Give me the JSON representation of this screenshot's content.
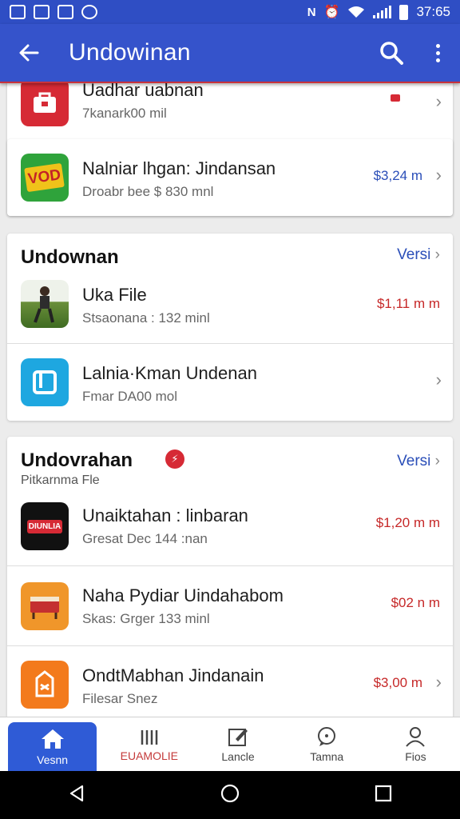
{
  "status_bar": {
    "time": "37:65"
  },
  "app_bar": {
    "title": "Undowinan"
  },
  "top_card": {
    "items": [
      {
        "title": "Uadhar uabnan",
        "subtitle": "7kanark00 mil",
        "price": ""
      },
      {
        "title": "Nalniar lhgan: Jindansan",
        "subtitle": "Droabr bee $ 830 mnl",
        "price": "$3,24 m"
      }
    ]
  },
  "section_one": {
    "title": "Undownan",
    "more_label": "Versi",
    "items": [
      {
        "title": "Uka File",
        "subtitle": "Stsaonana : 132 minl",
        "price": "$1,11 m m"
      },
      {
        "title": "Lalnia·Kman Undenan",
        "subtitle": "Fmar DA00 mol",
        "price": ""
      }
    ]
  },
  "section_two": {
    "title": "Undovrahan",
    "subtitle": "Pitkarnma Fle",
    "more_label": "Versi",
    "items": [
      {
        "title": "Unaiktahan : linbaran",
        "subtitle": "Gresat Dec 144 :nan",
        "price": "$1,20 m m",
        "icon_text": "DIUNLIA"
      },
      {
        "title": "Naha Pydiar Uindahabom",
        "subtitle": "Skas: Grger 133 minl",
        "price": "$02 n m"
      },
      {
        "title": "OndtMabhan Jindanain",
        "subtitle": "Filesar Snez",
        "price": "$3,00 m"
      }
    ]
  },
  "bottom_nav": [
    {
      "label": "Vesnn",
      "icon": "home-icon",
      "active": true
    },
    {
      "label": "EUAMOLIE",
      "icon": "bars-icon",
      "active": false
    },
    {
      "label": "Lancle",
      "icon": "edit-icon",
      "active": false
    },
    {
      "label": "Tamna",
      "icon": "chat-icon",
      "active": false
    },
    {
      "label": "Fios",
      "icon": "person-icon",
      "active": false
    }
  ],
  "colors": {
    "primary": "#3553cb",
    "price_blue": "#2a4eb8",
    "price_red": "#c62828",
    "active_nav": "#2f5bd6"
  }
}
